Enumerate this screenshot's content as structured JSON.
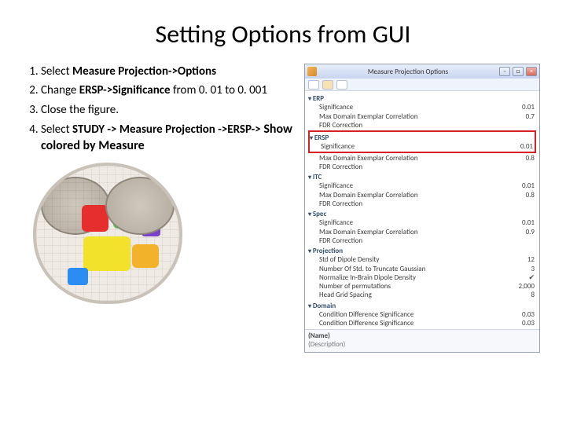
{
  "title": "Setting Options from GUI",
  "steps": {
    "s1a": "Select ",
    "s1b": "Measure Projection->Options",
    "s2a": "Change ",
    "s2b": "ERSP->Significance",
    "s2c": " from 0. 01 to 0. 001",
    "s3": "Close the figure.",
    "s4a": "Select ",
    "s4b": "STUDY -> Measure Projection ->ERSP->",
    "s4c": " Show colored by Measure"
  },
  "window": {
    "title": "Measure Projection Options",
    "min": "–",
    "max": "□",
    "close": "×",
    "sections": {
      "erp": {
        "label": "ERP",
        "rows": [
          {
            "name": "Significance",
            "val": "0.01"
          },
          {
            "name": "Max Domain Exemplar Correlation",
            "val": "0.7"
          },
          {
            "name": "FDR Correction",
            "val": ""
          }
        ]
      },
      "ersp": {
        "label": "ERSP",
        "rows": [
          {
            "name": "Significance",
            "val": "0.01"
          },
          {
            "name": "Max Domain Exemplar Correlation",
            "val": "0.8"
          },
          {
            "name": "FDR Correction",
            "val": ""
          }
        ]
      },
      "itc": {
        "label": "ITC",
        "rows": [
          {
            "name": "Significance",
            "val": "0.01"
          },
          {
            "name": "Max Domain Exemplar Correlation",
            "val": "0.8"
          },
          {
            "name": "FDR Correction",
            "val": ""
          }
        ]
      },
      "spec": {
        "label": "Spec",
        "rows": [
          {
            "name": "Significance",
            "val": "0.01"
          },
          {
            "name": "Max Domain Exemplar Correlation",
            "val": "0.9"
          },
          {
            "name": "FDR Correction",
            "val": ""
          }
        ]
      },
      "projection": {
        "label": "Projection",
        "rows": [
          {
            "name": "Std of Dipole Density",
            "val": "12"
          },
          {
            "name": "Number Of Std. to Truncate Gaussian",
            "val": "3"
          },
          {
            "name": "Normalize In-Brain Dipole Density",
            "val": "✔"
          },
          {
            "name": "Number of permutations",
            "val": "2,000"
          },
          {
            "name": "Head Grid Spacing",
            "val": "8"
          }
        ]
      },
      "domain": {
        "label": "Domain",
        "rows": [
          {
            "name": "Condition Difference Significance",
            "val": "0.03"
          },
          {
            "name": "Condition Difference Significance",
            "val": "0.03"
          }
        ]
      }
    },
    "footer": {
      "name": "(Name)",
      "desc": "(Description)"
    }
  }
}
